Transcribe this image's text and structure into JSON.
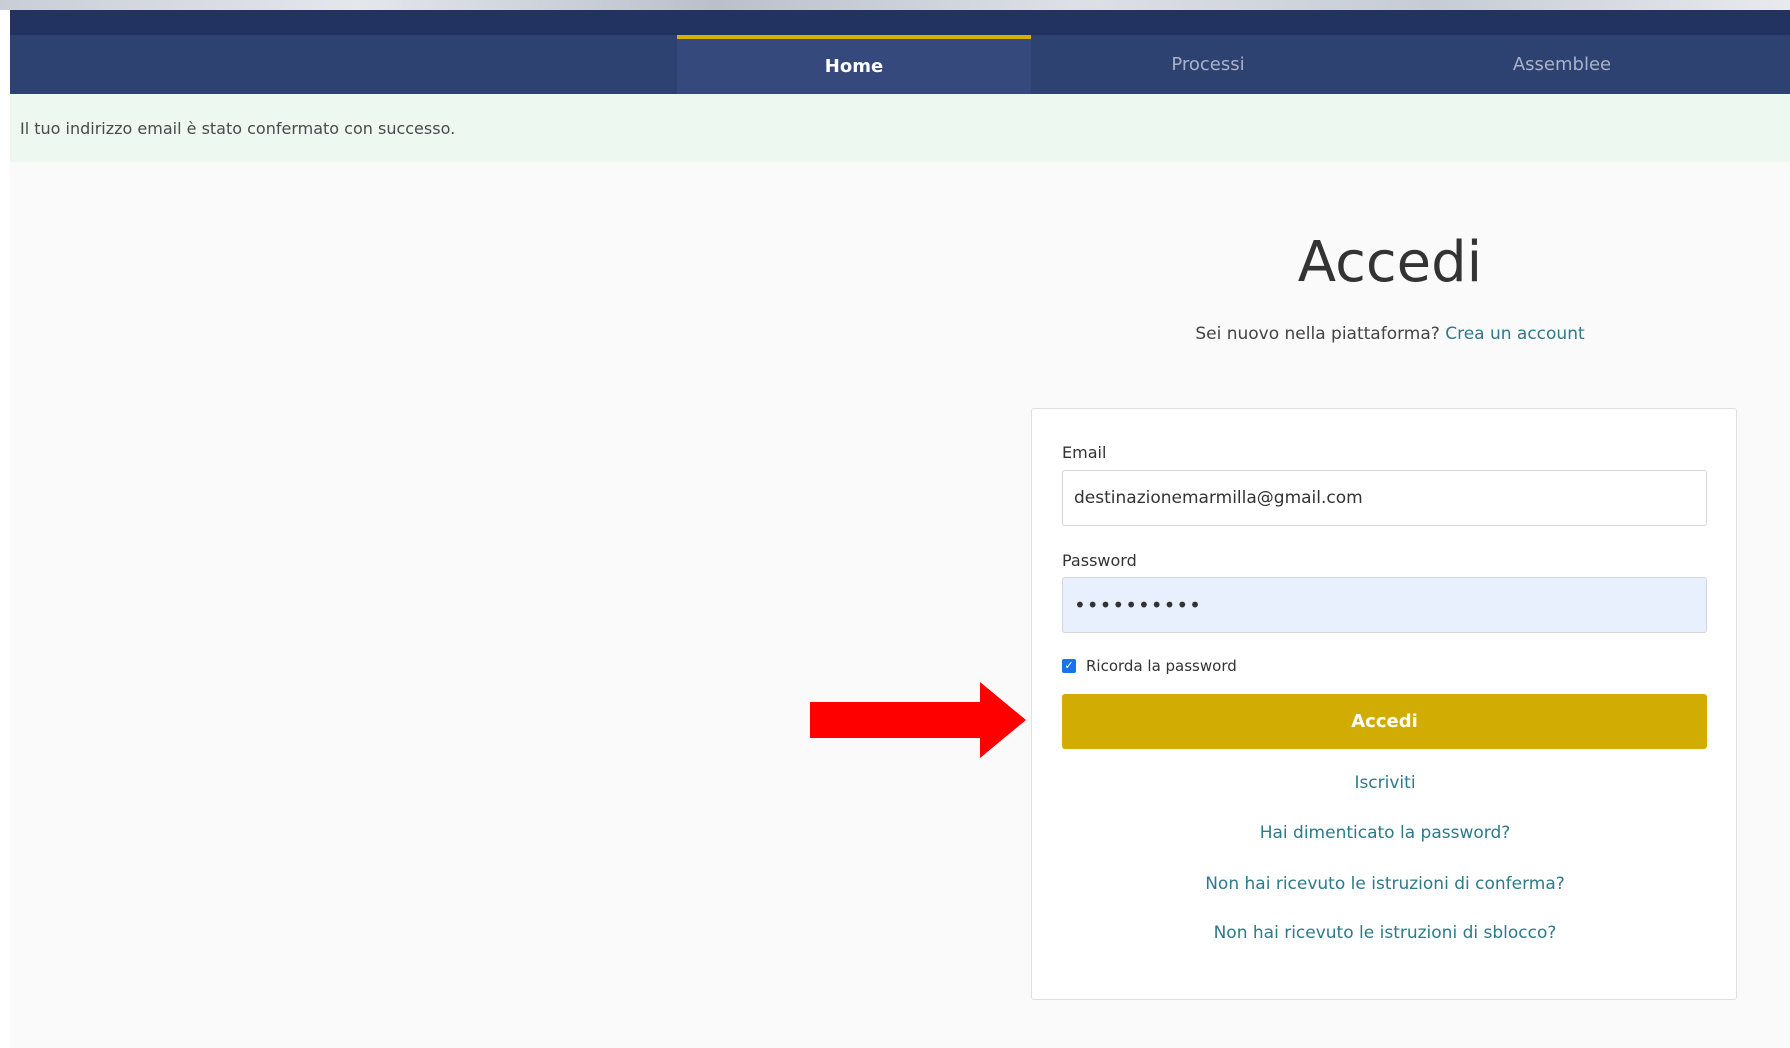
{
  "nav": {
    "tabs": [
      {
        "label": "Home",
        "active": true
      },
      {
        "label": "Processi",
        "active": false
      },
      {
        "label": "Assemblee",
        "active": false
      }
    ]
  },
  "flash": {
    "message": "Il tuo indirizzo email è stato confermato con successo."
  },
  "login": {
    "title": "Accedi",
    "new_user_prompt": "Sei nuovo nella piattaforma?",
    "create_account_link": "Crea un account",
    "email_label": "Email",
    "email_value": "destinazionemarmilla@gmail.com",
    "password_label": "Password",
    "password_value": "••••••••••",
    "remember_label": "Ricorda la password",
    "remember_checked": true,
    "submit_label": "Accedi",
    "links": {
      "register": "Iscriviti",
      "forgot_password": "Hai dimenticato la password?",
      "resend_confirmation": "Non hai ricevuto le istruzioni di conferma?",
      "resend_unlock": "Non hai ricevuto le istruzioni di sblocco?"
    }
  },
  "colors": {
    "header_band": "#223362",
    "navbar": "#2e4272",
    "nav_active": "#36497c",
    "accent": "#d1ad03",
    "link": "#2c7a8a",
    "flash_bg": "#edf8f0",
    "annotation_arrow": "#ff0000"
  }
}
